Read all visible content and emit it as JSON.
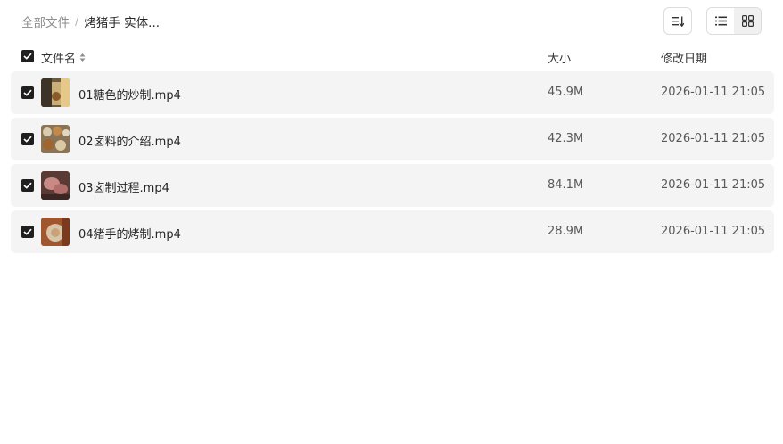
{
  "breadcrumb": {
    "root": "全部文件",
    "separator": "/",
    "current": "烤猪手 实体..."
  },
  "toolbar": {
    "sort_icon": "sort-icon",
    "list_view_icon": "list-view-icon",
    "grid_view_icon": "grid-view-icon"
  },
  "columns": {
    "name": "文件名",
    "size": "大小",
    "modified": "修改日期"
  },
  "files": [
    {
      "name": "01糖色的炒制.mp4",
      "size": "45.9M",
      "modified": "2026-01-11 21:05",
      "checked": true
    },
    {
      "name": "02卤料的介绍.mp4",
      "size": "42.3M",
      "modified": "2026-01-11 21:05",
      "checked": true
    },
    {
      "name": "03卤制过程.mp4",
      "size": "84.1M",
      "modified": "2026-01-11 21:05",
      "checked": true
    },
    {
      "name": "04猪手的烤制.mp4",
      "size": "28.9M",
      "modified": "2026-01-11 21:05",
      "checked": true
    }
  ],
  "colors": {
    "row_background": "#f4f4f4",
    "checkbox": "#1f1f1f"
  }
}
